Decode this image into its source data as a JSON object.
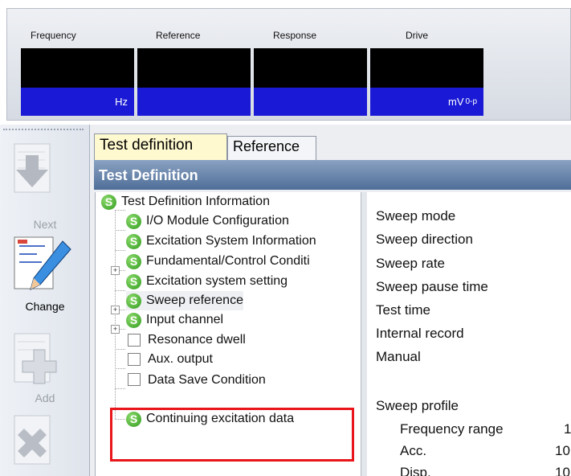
{
  "meters": [
    {
      "title": "Frequency",
      "unit": "Hz",
      "unit_sub": ""
    },
    {
      "title": "Reference",
      "unit": "",
      "unit_sub": ""
    },
    {
      "title": "Response",
      "unit": "",
      "unit_sub": ""
    },
    {
      "title": "Drive",
      "unit": "mV",
      "unit_sub": "0-p"
    }
  ],
  "sidebar": {
    "next_label": "Next",
    "change_label": "Change",
    "add_label": "Add"
  },
  "tabs": [
    "Test definition",
    "Reference"
  ],
  "section_header": "Test Definition",
  "tree": [
    {
      "label": "Test Definition Information",
      "icon": "s-icon"
    },
    {
      "label": "I/O Module Configuration",
      "icon": "s-icon"
    },
    {
      "label": "Excitation System Information",
      "icon": "s-icon"
    },
    {
      "label": "Fundamental/Control Conditi",
      "icon": "s-icon",
      "expandable": true
    },
    {
      "label": "Excitation system setting",
      "icon": "s-icon"
    },
    {
      "label": "Sweep reference",
      "icon": "s-icon",
      "expandable": true,
      "selected": true
    },
    {
      "label": "Input channel",
      "icon": "s-icon",
      "expandable": true
    },
    {
      "label": "Resonance dwell",
      "icon": "checkbox-icon"
    },
    {
      "label": "Aux. output",
      "icon": "checkbox-icon"
    },
    {
      "label": "Data Save Condition",
      "icon": "checkbox-icon"
    },
    {
      "label": "Continuing excitation data",
      "icon": "s-icon"
    }
  ],
  "details": {
    "sweep_mode": "Sweep mode",
    "sweep_direction": "Sweep direction",
    "sweep_rate": "Sweep rate",
    "sweep_pause_time": "Sweep pause time",
    "test_time": "Test time",
    "internal_record": "Internal record",
    "manual": "Manual",
    "sweep_profile": "Sweep profile",
    "frequency_range": "Frequency range",
    "frequency_range_value": "1",
    "acc": "Acc.",
    "acc_value": "10",
    "disp": "Disp.",
    "disp_value": "10"
  },
  "colors": {
    "meter_unit_bg": "#1a1ad6",
    "active_tab_bg": "#fff9cf",
    "highlight": "#e8151a",
    "s_icon_green": "#2f9a1c"
  }
}
